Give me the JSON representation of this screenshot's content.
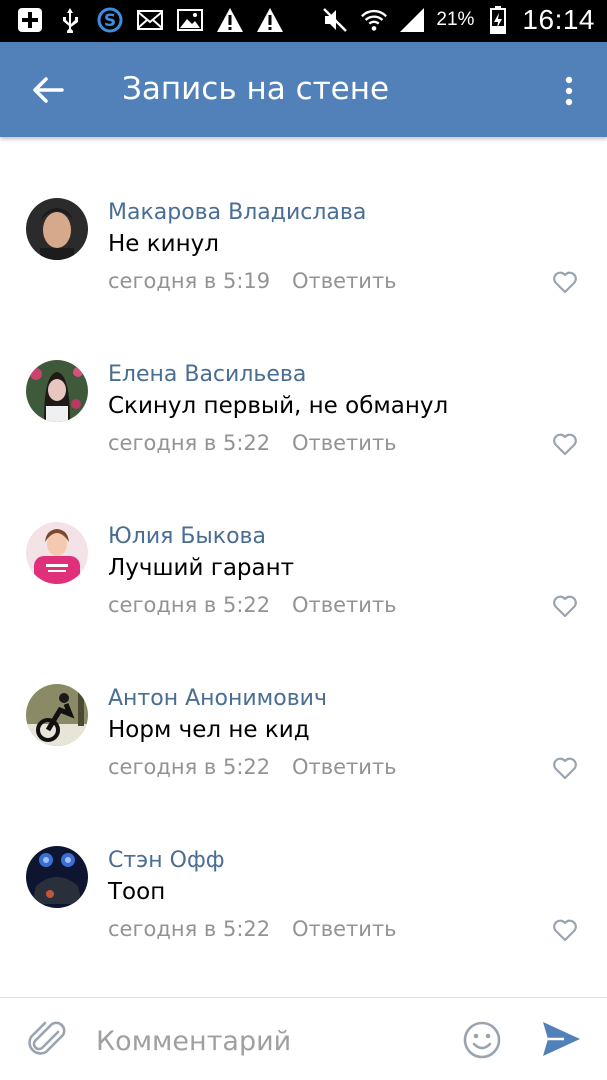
{
  "status_bar": {
    "battery_percent": "21%",
    "time": "16:14",
    "left_icons": [
      "add-icon",
      "usb-icon",
      "skype-icon",
      "mail-icon",
      "gallery-icon",
      "warning-icon",
      "warning-icon"
    ],
    "right_icons": [
      "mute-icon",
      "wifi-icon",
      "signal-icon",
      "battery-charging-icon"
    ]
  },
  "app_bar": {
    "title": "Запись на стене",
    "background": "#5181b8"
  },
  "comments": [
    {
      "author": "Макарова Владислава",
      "text": "Не кинул",
      "time": "сегодня в 5:19",
      "reply_label": "Ответить",
      "avatar_colors": [
        "#2b2b2b",
        "#d6a88c"
      ]
    },
    {
      "author": "Елена Васильева",
      "text": "Скинул первый, не обманул",
      "time": "сегодня в 5:22",
      "reply_label": "Ответить",
      "avatar_colors": [
        "#3f5a3a",
        "#e8c6c0"
      ]
    },
    {
      "author": "Юлия Быкова",
      "text": "Лучший гарант",
      "time": "сегодня в 5:22",
      "reply_label": "Ответить",
      "avatar_colors": [
        "#e0307a",
        "#f4c9b0"
      ]
    },
    {
      "author": "Антон Анонимович",
      "text": "Норм чел не кид",
      "time": "сегодня в 5:22",
      "reply_label": "Ответить",
      "avatar_colors": [
        "#6b6b4a",
        "#1a1a1a"
      ]
    },
    {
      "author": "Стэн Офф",
      "text": "Тооп",
      "time": "сегодня в 5:22",
      "reply_label": "Ответить",
      "avatar_colors": [
        "#0e1530",
        "#3a6fd0"
      ]
    }
  ],
  "input_bar": {
    "placeholder": "Комментарий",
    "send_color": "#5181b8"
  }
}
